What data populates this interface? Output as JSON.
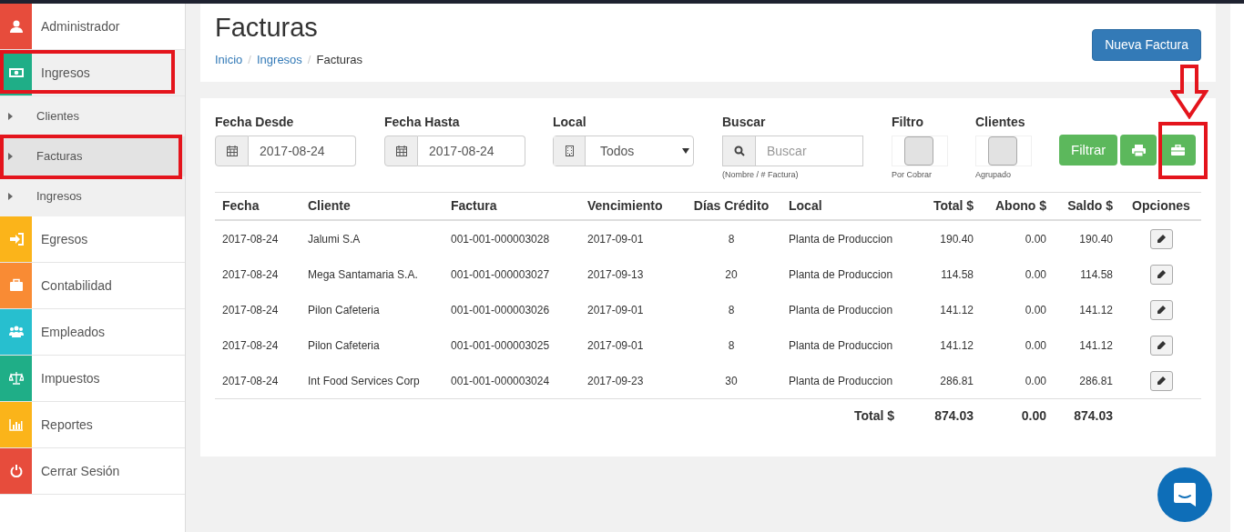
{
  "sidebar": {
    "items": [
      {
        "label": "Administrador",
        "color": "#e74c3c",
        "expanded": false
      },
      {
        "label": "Ingresos",
        "color": "#1fae87",
        "expanded": true,
        "children": [
          {
            "label": "Clientes",
            "selected": false
          },
          {
            "label": "Facturas",
            "selected": true
          },
          {
            "label": "Ingresos",
            "selected": false
          }
        ]
      },
      {
        "label": "Egresos",
        "color": "#fbb41a",
        "expanded": false
      },
      {
        "label": "Contabilidad",
        "color": "#f98b34",
        "expanded": false
      },
      {
        "label": "Empleados",
        "color": "#27bfcf",
        "expanded": false
      },
      {
        "label": "Impuestos",
        "color": "#1fae87",
        "expanded": false
      },
      {
        "label": "Reportes",
        "color": "#fbb41a",
        "expanded": false
      },
      {
        "label": "Cerrar Sesión",
        "color": "#e74c3c",
        "expanded": false
      }
    ]
  },
  "header": {
    "title": "Facturas",
    "breadcrumb": [
      {
        "label": "Inicio",
        "link": true,
        "separator": "/"
      },
      {
        "label": "Ingresos",
        "link": true,
        "separator": "/"
      },
      {
        "label": "Facturas",
        "link": false
      }
    ],
    "new_button": "Nueva Factura"
  },
  "filters": {
    "fecha_desde": {
      "label": "Fecha Desde",
      "value": "2017-08-24"
    },
    "fecha_hasta": {
      "label": "Fecha Hasta",
      "value": "2017-08-24"
    },
    "local": {
      "label": "Local",
      "value": "Todos"
    },
    "buscar": {
      "label": "Buscar",
      "placeholder": "Buscar",
      "hint": "(Nombre / # Factura)"
    },
    "toggles": [
      {
        "label": "Filtro",
        "caption": "Por Cobrar",
        "on": false
      },
      {
        "label": "Clientes",
        "caption": "Agrupado",
        "on": false
      }
    ],
    "filter_button": "Filtrar"
  },
  "table": {
    "columns": [
      "Fecha",
      "Cliente",
      "Factura",
      "Vencimiento",
      "Días Crédito",
      "Local",
      "Total $",
      "Abono $",
      "Saldo $",
      "Opciones"
    ],
    "rows": [
      [
        "2017-08-24",
        "Jalumi S.A",
        "001-001-000003028",
        "2017-09-01",
        "8",
        "Planta de Produccion",
        "190.40",
        "0.00",
        "190.40"
      ],
      [
        "2017-08-24",
        "Mega Santamaria S.A.",
        "001-001-000003027",
        "2017-09-13",
        "20",
        "Planta de Produccion",
        "114.58",
        "0.00",
        "114.58"
      ],
      [
        "2017-08-24",
        "Pilon Cafeteria",
        "001-001-000003026",
        "2017-09-01",
        "8",
        "Planta de Produccion",
        "141.12",
        "0.00",
        "141.12"
      ],
      [
        "2017-08-24",
        "Pilon Cafeteria",
        "001-001-000003025",
        "2017-09-01",
        "8",
        "Planta de Produccion",
        "141.12",
        "0.00",
        "141.12"
      ],
      [
        "2017-08-24",
        "Int Food Services Corp",
        "001-001-000003024",
        "2017-09-23",
        "30",
        "Planta de Produccion",
        "286.81",
        "0.00",
        "286.81"
      ]
    ],
    "totals": {
      "label": "Total $",
      "total": "874.03",
      "abono": "0.00",
      "saldo": "874.03"
    }
  }
}
